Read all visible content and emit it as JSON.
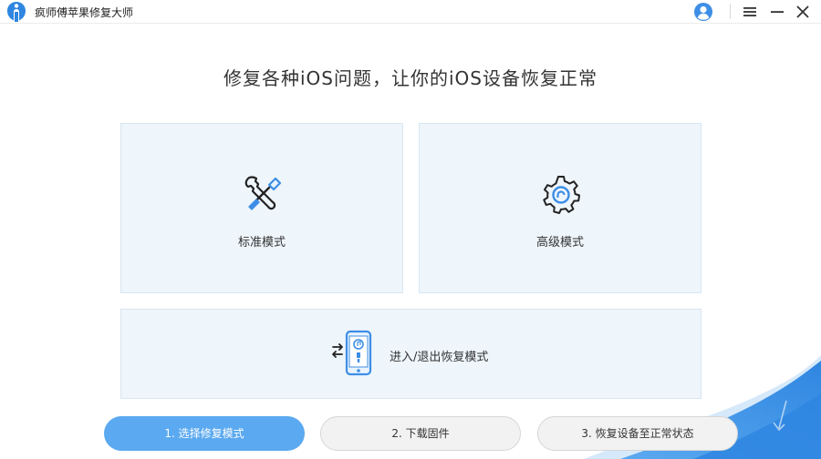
{
  "app": {
    "title": "疯师傅苹果修复大师"
  },
  "headline": "修复各种iOS问题，让你的iOS设备恢复正常",
  "modes": {
    "standard": {
      "label": "标准模式",
      "icon": "wrench-screwdriver-icon"
    },
    "advanced": {
      "label": "高级模式",
      "icon": "gear-icon"
    },
    "recovery": {
      "label": "进入/退出恢复模式",
      "icon": "phone-recovery-icon"
    }
  },
  "steps": [
    {
      "label": "1. 选择修复模式",
      "active": true
    },
    {
      "label": "2. 下载固件",
      "active": false
    },
    {
      "label": "3. 恢复设备至正常状态",
      "active": false
    }
  ],
  "colors": {
    "accent": "#5ba9f0",
    "card_bg": "#eef5fb",
    "icon_blue": "#2f86e0"
  }
}
